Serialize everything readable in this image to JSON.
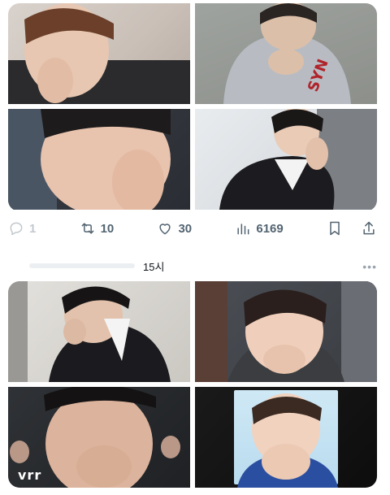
{
  "tweet_top": {
    "media": [
      {
        "alt": "photo-1"
      },
      {
        "alt": "photo-2"
      },
      {
        "alt": "photo-3"
      },
      {
        "alt": "photo-4"
      }
    ]
  },
  "actions": {
    "reply_count": "1",
    "retweet_count": "10",
    "like_count": "30",
    "views_count": "6169"
  },
  "tweet_meta": {
    "timestamp": "15시",
    "more_label": "•••"
  },
  "tweet_bottom": {
    "overlay_text": "vrr"
  },
  "colors": {
    "icon_gray": "#536471",
    "text_dark": "#0f1419"
  }
}
